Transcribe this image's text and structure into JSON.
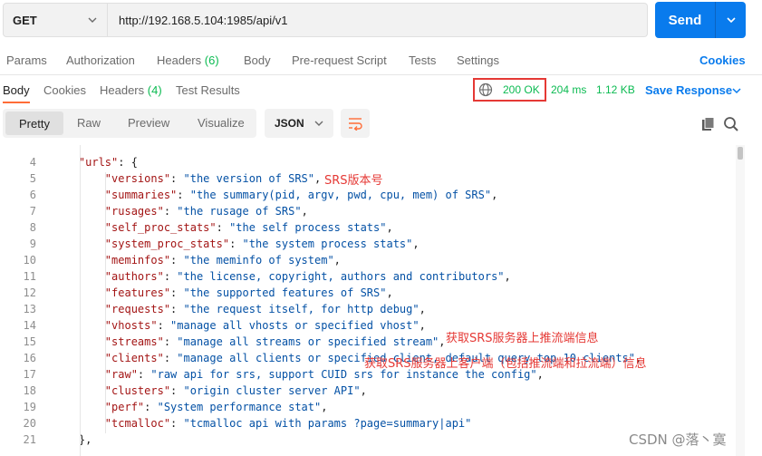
{
  "request": {
    "method": "GET",
    "url": "http://192.168.5.104:1985/api/v1",
    "send_label": "Send"
  },
  "request_tabs": {
    "params": "Params",
    "authorization": "Authorization",
    "headers": "Headers",
    "headers_count": "(6)",
    "body": "Body",
    "prerequest": "Pre-request Script",
    "tests": "Tests",
    "settings": "Settings",
    "cookies": "Cookies"
  },
  "response_tabs": {
    "body": "Body",
    "cookies": "Cookies",
    "headers": "Headers",
    "headers_count": "(4)",
    "test_results": "Test Results"
  },
  "response_meta": {
    "status": "200 OK",
    "time": "204 ms",
    "size": "1.12 KB",
    "save_response": "Save Response"
  },
  "view_toolbar": {
    "pretty": "Pretty",
    "raw": "Raw",
    "preview": "Preview",
    "visualize": "Visualize",
    "format": "JSON"
  },
  "code_lines": [
    {
      "n": "4",
      "indent": "    ",
      "key": "\"urls\"",
      "value": "{",
      "value_class": "plain"
    },
    {
      "n": "5",
      "indent": "        ",
      "key": "\"versions\"",
      "value": "\"the version of SRS\"",
      "tail": ","
    },
    {
      "n": "6",
      "indent": "        ",
      "key": "\"summaries\"",
      "value": "\"the summary(pid, argv, pwd, cpu, mem) of SRS\"",
      "tail": ","
    },
    {
      "n": "7",
      "indent": "        ",
      "key": "\"rusages\"",
      "value": "\"the rusage of SRS\"",
      "tail": ","
    },
    {
      "n": "8",
      "indent": "        ",
      "key": "\"self_proc_stats\"",
      "value": "\"the self process stats\"",
      "tail": ","
    },
    {
      "n": "9",
      "indent": "        ",
      "key": "\"system_proc_stats\"",
      "value": "\"the system process stats\"",
      "tail": ","
    },
    {
      "n": "10",
      "indent": "        ",
      "key": "\"meminfos\"",
      "value": "\"the meminfo of system\"",
      "tail": ","
    },
    {
      "n": "11",
      "indent": "        ",
      "key": "\"authors\"",
      "value": "\"the license, copyright, authors and contributors\"",
      "tail": ","
    },
    {
      "n": "12",
      "indent": "        ",
      "key": "\"features\"",
      "value": "\"the supported features of SRS\"",
      "tail": ","
    },
    {
      "n": "13",
      "indent": "        ",
      "key": "\"requests\"",
      "value": "\"the request itself, for http debug\"",
      "tail": ","
    },
    {
      "n": "14",
      "indent": "        ",
      "key": "\"vhosts\"",
      "value": "\"manage all vhosts or specified vhost\"",
      "tail": ","
    },
    {
      "n": "15",
      "indent": "        ",
      "key": "\"streams\"",
      "value": "\"manage all streams or specified stream\"",
      "tail": ","
    },
    {
      "n": "16",
      "indent": "        ",
      "key": "\"clients\"",
      "value": "\"manage all clients or specified client, default query top 10 clients\"",
      "tail": ","
    },
    {
      "n": "17",
      "indent": "        ",
      "key": "\"raw\"",
      "value": "\"raw api for srs, support CUID srs for instance the config\"",
      "tail": ","
    },
    {
      "n": "18",
      "indent": "        ",
      "key": "\"clusters\"",
      "value": "\"origin cluster server API\"",
      "tail": ","
    },
    {
      "n": "19",
      "indent": "        ",
      "key": "\"perf\"",
      "value": "\"System performance stat\"",
      "tail": ","
    },
    {
      "n": "20",
      "indent": "        ",
      "key": "\"tcmalloc\"",
      "value": "\"tcmalloc api with params ?page=summary|api\"",
      "tail": ""
    },
    {
      "n": "21",
      "indent": "    ",
      "key": "},",
      "value": "",
      "tail": "",
      "value_class": "plain"
    }
  ],
  "annotations": {
    "versions_note": "SRS版本号",
    "streams_note": "获取SRS服务器上推流端信息",
    "clients_note": "获取SRS服务器上客户端（包括推流端和拉流端）信息"
  },
  "watermark": "CSDN @落丶寞",
  "colors": {
    "accent": "#097bed",
    "status_ok": "#0cbb52",
    "annotation_red": "#e53935",
    "tab_underline": "#ff6c37"
  },
  "icons": [
    "chevron-down-icon",
    "globe-icon",
    "wrap-lines-icon",
    "copy-icon",
    "search-icon"
  ]
}
